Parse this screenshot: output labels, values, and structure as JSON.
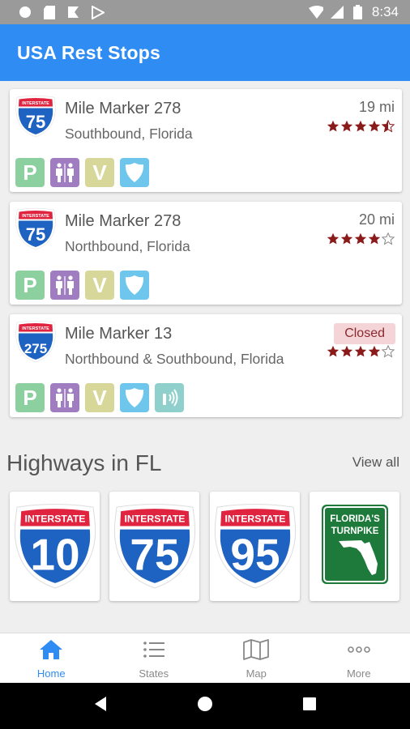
{
  "status_bar": {
    "time": "8:34"
  },
  "app_bar": {
    "title": "USA Rest Stops"
  },
  "colors": {
    "primary": "#2f8cf3",
    "star": "#8b1a1a",
    "parking": "#8dd0a0",
    "restroom": "#a07cc0",
    "vending": "#d8d79a",
    "security": "#6ec6ec",
    "wifi": "#8fd0cc",
    "interstate_blue": "#1e62c2",
    "interstate_red": "#e0233f",
    "turnpike_green": "#1d7a3a"
  },
  "rest_stops": [
    {
      "highway": "75",
      "shield_label": "INTERSTATE",
      "title": "Mile Marker 278",
      "location": "Southbound, Florida",
      "distance": "19 mi",
      "status": "",
      "rating": 4.5,
      "amenities": [
        "P",
        "restroom",
        "V",
        "security"
      ]
    },
    {
      "highway": "75",
      "shield_label": "INTERSTATE",
      "title": "Mile Marker 278",
      "location": "Northbound, Florida",
      "distance": "20 mi",
      "status": "",
      "rating": 4,
      "amenities": [
        "P",
        "restroom",
        "V",
        "security"
      ]
    },
    {
      "highway": "275",
      "shield_label": "INTERSTATE",
      "title": "Mile Marker 13",
      "location": "Northbound & Southbound, Florida",
      "distance": "",
      "status": "Closed",
      "rating": 4,
      "amenities": [
        "P",
        "restroom",
        "V",
        "security",
        "wifi"
      ]
    }
  ],
  "highways": {
    "title": "Highways in FL",
    "view_all": "View all",
    "items": [
      {
        "type": "interstate",
        "label": "INTERSTATE",
        "number": "10"
      },
      {
        "type": "interstate",
        "label": "INTERSTATE",
        "number": "75"
      },
      {
        "type": "interstate",
        "label": "INTERSTATE",
        "number": "95"
      },
      {
        "type": "turnpike",
        "line1": "FLORIDA'S",
        "line2": "TURNPIKE"
      }
    ]
  },
  "bottom_nav": [
    {
      "label": "Home",
      "icon": "home-icon",
      "active": true
    },
    {
      "label": "States",
      "icon": "list-icon",
      "active": false
    },
    {
      "label": "Map",
      "icon": "map-icon",
      "active": false
    },
    {
      "label": "More",
      "icon": "more-icon",
      "active": false
    }
  ]
}
